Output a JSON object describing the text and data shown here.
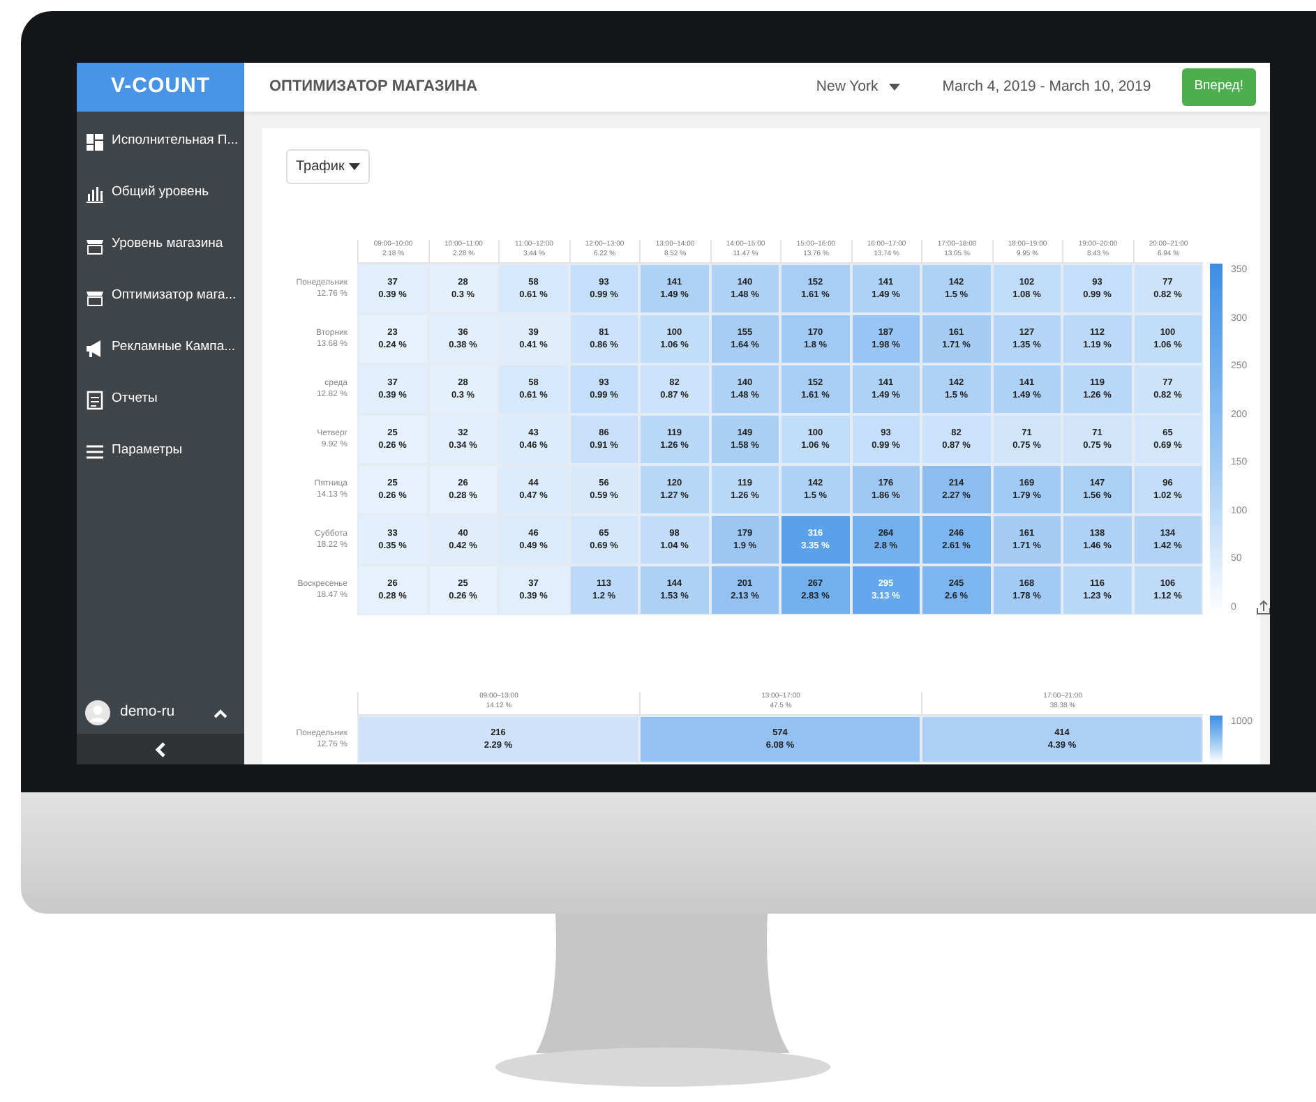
{
  "logo": "V-COUNT",
  "sidebar": {
    "items": [
      {
        "label": "Исполнительная П..."
      },
      {
        "label": "Общий уровень"
      },
      {
        "label": "Уровень магазина"
      },
      {
        "label": "Оптимизатор мага..."
      },
      {
        "label": "Рекламные Кампа..."
      },
      {
        "label": "Отчеты"
      },
      {
        "label": "Параметры"
      }
    ],
    "user": "demo-ru"
  },
  "topbar": {
    "title": "ОПТИМИЗАТОР МАГАЗИНА",
    "location": "New York",
    "date_range": "March 4, 2019 - March 10, 2019",
    "button": "Вперед!"
  },
  "filter": {
    "label": "Трафик"
  },
  "heatmaps": [
    {
      "columns": [
        {
          "time": "09:00–10:00",
          "share": "2.18 %"
        },
        {
          "time": "10:00–11:00",
          "share": "2.28 %"
        },
        {
          "time": "11:00–12:00",
          "share": "3.44 %"
        },
        {
          "time": "12:00–13:00",
          "share": "6.22 %"
        },
        {
          "time": "13:00–14:00",
          "share": "8.52 %"
        },
        {
          "time": "14:00–15:00",
          "share": "11.47 %"
        },
        {
          "time": "15:00–16:00",
          "share": "13.76 %"
        },
        {
          "time": "16:00–17:00",
          "share": "13.74 %"
        },
        {
          "time": "17:00–18:00",
          "share": "13.05 %"
        },
        {
          "time": "18:00–19:00",
          "share": "9.95 %"
        },
        {
          "time": "19:00–20:00",
          "share": "8.43 %"
        },
        {
          "time": "20:00–21:00",
          "share": "6.94 %"
        }
      ],
      "rows": [
        {
          "day": "Понедельник",
          "share": "12.76 %",
          "cells": [
            [
              "37",
              "0.39 %"
            ],
            [
              "28",
              "0.3 %"
            ],
            [
              "58",
              "0.61 %"
            ],
            [
              "93",
              "0.99 %"
            ],
            [
              "141",
              "1.49 %"
            ],
            [
              "140",
              "1.48 %"
            ],
            [
              "152",
              "1.61 %"
            ],
            [
              "141",
              "1.49 %"
            ],
            [
              "142",
              "1.5 %"
            ],
            [
              "102",
              "1.08 %"
            ],
            [
              "93",
              "0.99 %"
            ],
            [
              "77",
              "0.82 %"
            ]
          ]
        },
        {
          "day": "Вторник",
          "share": "13.68 %",
          "cells": [
            [
              "23",
              "0.24 %"
            ],
            [
              "36",
              "0.38 %"
            ],
            [
              "39",
              "0.41 %"
            ],
            [
              "81",
              "0.86 %"
            ],
            [
              "100",
              "1.06 %"
            ],
            [
              "155",
              "1.64 %"
            ],
            [
              "170",
              "1.8 %"
            ],
            [
              "187",
              "1.98 %"
            ],
            [
              "161",
              "1.71 %"
            ],
            [
              "127",
              "1.35 %"
            ],
            [
              "112",
              "1.19 %"
            ],
            [
              "100",
              "1.06 %"
            ]
          ]
        },
        {
          "day": "среда",
          "share": "12.82 %",
          "cells": [
            [
              "37",
              "0.39 %"
            ],
            [
              "28",
              "0.3 %"
            ],
            [
              "58",
              "0.61 %"
            ],
            [
              "93",
              "0.99 %"
            ],
            [
              "82",
              "0.87 %"
            ],
            [
              "140",
              "1.48 %"
            ],
            [
              "152",
              "1.61 %"
            ],
            [
              "141",
              "1.49 %"
            ],
            [
              "142",
              "1.5 %"
            ],
            [
              "141",
              "1.49 %"
            ],
            [
              "119",
              "1.26 %"
            ],
            [
              "77",
              "0.82 %"
            ]
          ]
        },
        {
          "day": "Четверг",
          "share": "9.92 %",
          "cells": [
            [
              "25",
              "0.26 %"
            ],
            [
              "32",
              "0.34 %"
            ],
            [
              "43",
              "0.46 %"
            ],
            [
              "86",
              "0.91 %"
            ],
            [
              "119",
              "1.26 %"
            ],
            [
              "149",
              "1.58 %"
            ],
            [
              "100",
              "1.06 %"
            ],
            [
              "93",
              "0.99 %"
            ],
            [
              "82",
              "0.87 %"
            ],
            [
              "71",
              "0.75 %"
            ],
            [
              "71",
              "0.75 %"
            ],
            [
              "65",
              "0.69 %"
            ]
          ]
        },
        {
          "day": "Пятница",
          "share": "14.13 %",
          "cells": [
            [
              "25",
              "0.26 %"
            ],
            [
              "26",
              "0.28 %"
            ],
            [
              "44",
              "0.47 %"
            ],
            [
              "56",
              "0.59 %"
            ],
            [
              "120",
              "1.27 %"
            ],
            [
              "119",
              "1.26 %"
            ],
            [
              "142",
              "1.5 %"
            ],
            [
              "176",
              "1.86 %"
            ],
            [
              "214",
              "2.27 %"
            ],
            [
              "169",
              "1.79 %"
            ],
            [
              "147",
              "1.56 %"
            ],
            [
              "96",
              "1.02 %"
            ]
          ]
        },
        {
          "day": "Суббота",
          "share": "18.22 %",
          "cells": [
            [
              "33",
              "0.35 %"
            ],
            [
              "40",
              "0.42 %"
            ],
            [
              "46",
              "0.49 %"
            ],
            [
              "65",
              "0.69 %"
            ],
            [
              "98",
              "1.04 %"
            ],
            [
              "179",
              "1.9 %"
            ],
            [
              "316",
              "3.35 %"
            ],
            [
              "264",
              "2.8 %"
            ],
            [
              "246",
              "2.61 %"
            ],
            [
              "161",
              "1.71 %"
            ],
            [
              "138",
              "1.46 %"
            ],
            [
              "134",
              "1.42 %"
            ]
          ]
        },
        {
          "day": "Воскресенье",
          "share": "18.47 %",
          "cells": [
            [
              "26",
              "0.28 %"
            ],
            [
              "25",
              "0.26 %"
            ],
            [
              "37",
              "0.39 %"
            ],
            [
              "113",
              "1.2 %"
            ],
            [
              "144",
              "1.53 %"
            ],
            [
              "201",
              "2.13 %"
            ],
            [
              "267",
              "2.83 %"
            ],
            [
              "295",
              "3.13 %"
            ],
            [
              "245",
              "2.6 %"
            ],
            [
              "168",
              "1.78 %"
            ],
            [
              "116",
              "1.23 %"
            ],
            [
              "106",
              "1.12 %"
            ]
          ]
        }
      ],
      "legend": [
        "350",
        "300",
        "250",
        "200",
        "150",
        "100",
        "50",
        "0"
      ]
    },
    {
      "columns": [
        {
          "time": "09:00–13:00",
          "share": "14.12 %"
        },
        {
          "time": "13:00–17:00",
          "share": "47.5 %"
        },
        {
          "time": "17:00–21:00",
          "share": "38.38 %"
        }
      ],
      "rows": [
        {
          "day": "Понедельник",
          "share": "12.76 %",
          "cells": [
            [
              "216",
              "2.29 %"
            ],
            [
              "574",
              "6.08 %"
            ],
            [
              "414",
              "4.39 %"
            ]
          ]
        }
      ],
      "legend": [
        "1000"
      ]
    }
  ]
}
